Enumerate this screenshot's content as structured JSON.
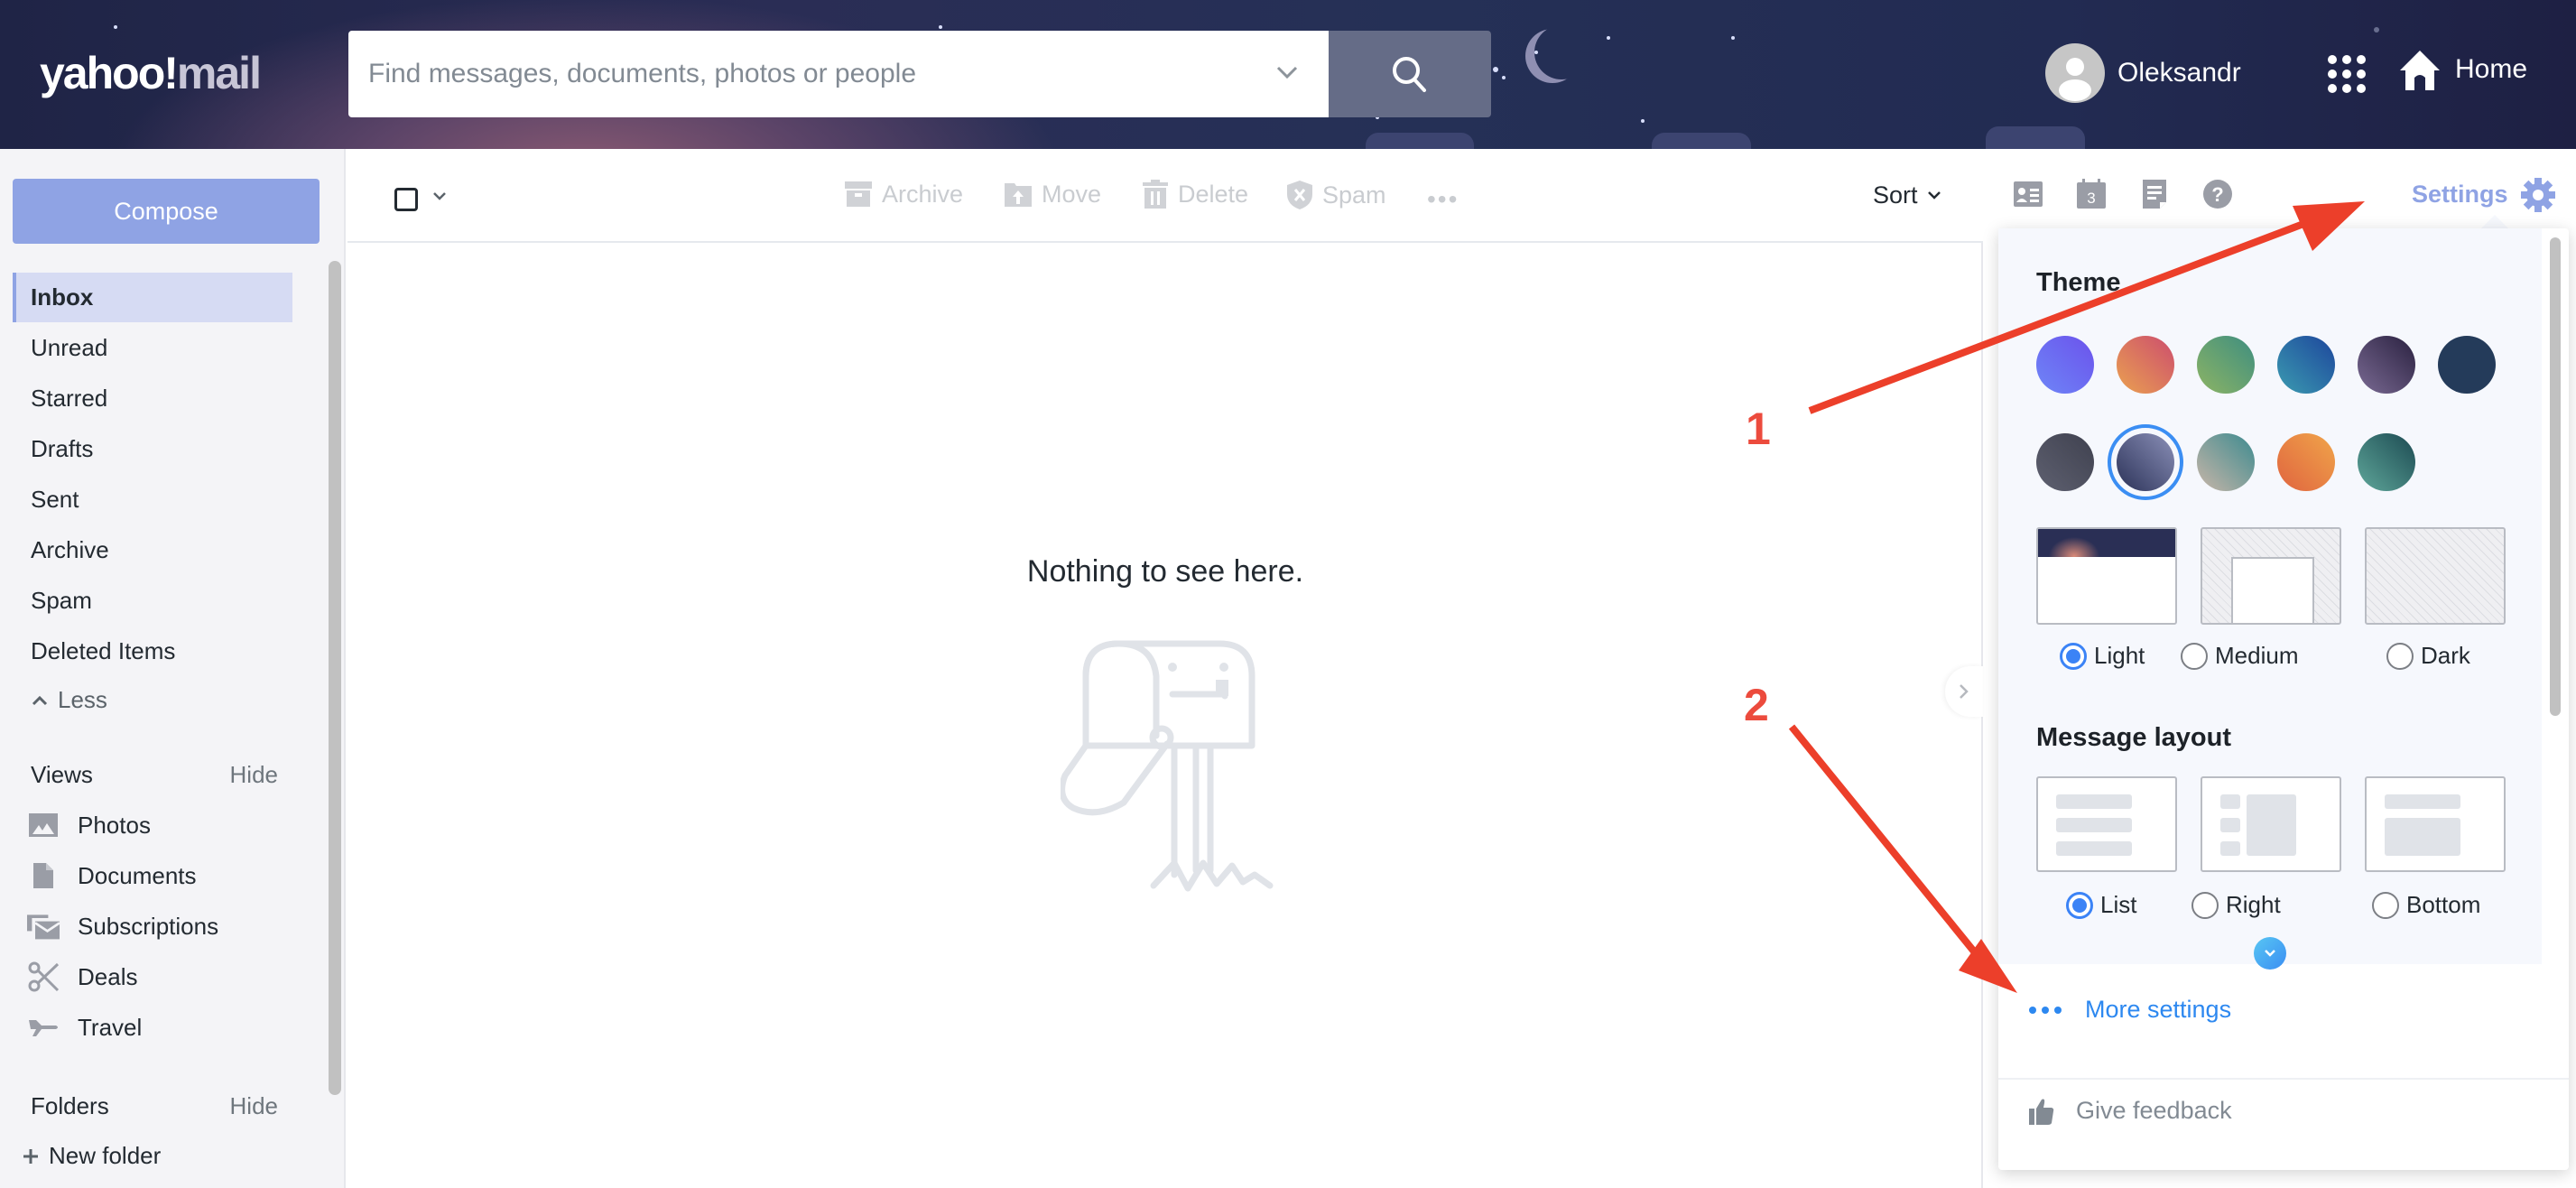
{
  "header": {
    "logo_yahoo": "yahoo!",
    "logo_mail": "mail",
    "search_placeholder": "Find messages, documents, photos or people",
    "search_value": "",
    "user_name": "Oleksandr",
    "home_label": "Home"
  },
  "sidebar": {
    "compose_label": "Compose",
    "folders": [
      {
        "label": "Inbox",
        "active": true
      },
      {
        "label": "Unread"
      },
      {
        "label": "Starred"
      },
      {
        "label": "Drafts"
      },
      {
        "label": "Sent"
      },
      {
        "label": "Archive"
      },
      {
        "label": "Spam"
      },
      {
        "label": "Deleted Items"
      }
    ],
    "less_label": "Less",
    "views_heading": "Views",
    "views_hide": "Hide",
    "views": [
      {
        "label": "Photos",
        "icon": "photo-icon"
      },
      {
        "label": "Documents",
        "icon": "document-icon"
      },
      {
        "label": "Subscriptions",
        "icon": "subscriptions-icon"
      },
      {
        "label": "Deals",
        "icon": "scissors-icon"
      },
      {
        "label": "Travel",
        "icon": "airplane-icon"
      }
    ],
    "folders_heading": "Folders",
    "folders_hide": "Hide",
    "new_folder_label": "New folder"
  },
  "toolbar": {
    "archive": "Archive",
    "move": "Move",
    "delete": "Delete",
    "spam": "Spam",
    "more": "•••",
    "sort": "Sort"
  },
  "message_list": {
    "empty_text": "Nothing to see here."
  },
  "right_rail": {
    "calendar_day": "3",
    "settings_label": "Settings"
  },
  "settings_panel": {
    "theme_heading": "Theme",
    "theme_swatches": [
      {
        "name": "purple-blue",
        "from": "#6e86f7",
        "to": "#6b52ec"
      },
      {
        "name": "orange-pink",
        "from": "#eaa150",
        "to": "#cc4d6e"
      },
      {
        "name": "green",
        "from": "#8db464",
        "to": "#3e8e80"
      },
      {
        "name": "blue",
        "from": "#3b9bb0",
        "to": "#1d469c"
      },
      {
        "name": "plum",
        "from": "#7a6a93",
        "to": "#2a2140"
      },
      {
        "name": "navy",
        "from": "#243b5a",
        "to": "#243b5a"
      },
      {
        "name": "slate",
        "from": "#5e6070",
        "to": "#3f414f"
      },
      {
        "name": "night-mountains",
        "from": "#2b3258",
        "to": "#8b90b8",
        "selected": true
      },
      {
        "name": "camper",
        "from": "#c9b6a8",
        "to": "#3c8a8f"
      },
      {
        "name": "sunset-cliff",
        "from": "#e0643f",
        "to": "#f0a54a"
      },
      {
        "name": "teal-mountains",
        "from": "#5fa79a",
        "to": "#1c4a52"
      }
    ],
    "modes": [
      {
        "label": "Light",
        "selected": true
      },
      {
        "label": "Medium",
        "selected": false
      },
      {
        "label": "Dark",
        "selected": false
      }
    ],
    "layout_heading": "Message layout",
    "layouts": [
      {
        "label": "List",
        "selected": true
      },
      {
        "label": "Right",
        "selected": false
      },
      {
        "label": "Bottom",
        "selected": false
      }
    ],
    "more_settings_label": "More settings",
    "feedback_label": "Give feedback"
  },
  "annotations": {
    "step1": "1",
    "step2": "2",
    "color": "#ec4b3d"
  }
}
